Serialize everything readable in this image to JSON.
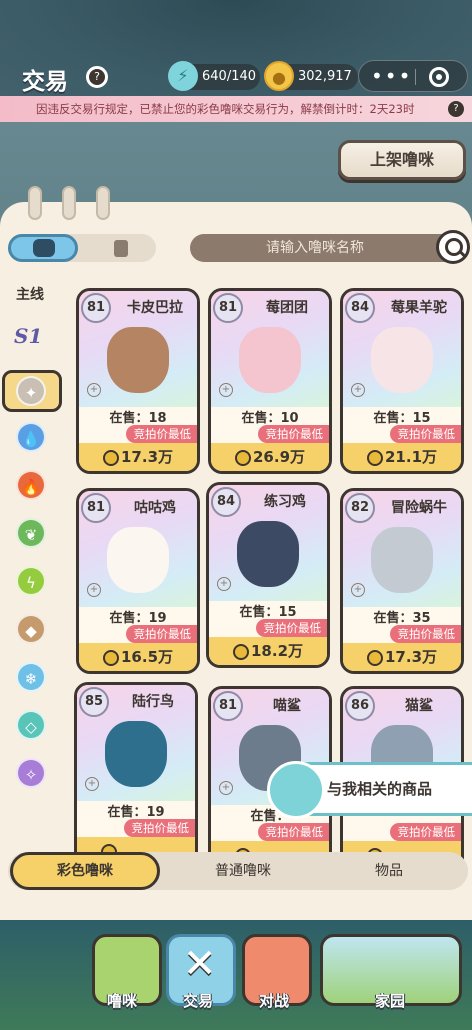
{
  "header": {
    "title": "交易",
    "energy": "640/140",
    "coins": "302,917"
  },
  "banner": {
    "text": "因违反交易行规定，已禁止您的彩色噜咪交易行为，解禁倒计时：2天23时"
  },
  "actions": {
    "list_label": "上架噜咪"
  },
  "search": {
    "placeholder": "请输入噜咪名称"
  },
  "sidebar": {
    "label": "主线",
    "season": "S1",
    "icons": [
      "neutral",
      "water",
      "fire",
      "grass",
      "electric",
      "earth",
      "ice",
      "crystal",
      "spirit"
    ]
  },
  "cards": [
    {
      "level": "81",
      "name": "卡皮巴拉",
      "stock": "在售：18",
      "tag": "竞拍价最低",
      "price": "17.3万",
      "color": "#b48463"
    },
    {
      "level": "81",
      "name": "莓团团",
      "stock": "在售：10",
      "tag": "竞拍价最低",
      "price": "26.9万",
      "color": "#f4c4cf"
    },
    {
      "level": "84",
      "name": "莓果羊驼",
      "stock": "在售：15",
      "tag": "竞拍价最低",
      "price": "21.1万",
      "color": "#f7e4e6"
    },
    {
      "level": "81",
      "name": "咕咕鸡",
      "stock": "在售：19",
      "tag": "竞拍价最低",
      "price": "16.5万",
      "color": "#fbf6ef"
    },
    {
      "level": "84",
      "name": "练习鸡",
      "stock": "在售：15",
      "tag": "竞拍价最低",
      "price": "18.2万",
      "color": "#3d4a63"
    },
    {
      "level": "82",
      "name": "冒险蜗牛",
      "stock": "在售：35",
      "tag": "竞拍价最低",
      "price": "17.3万",
      "color": "#c4cad2"
    },
    {
      "level": "85",
      "name": "陆行鸟",
      "stock": "在售：19",
      "tag": "竞拍价最低",
      "price": "",
      "color": "#2d6f8c"
    },
    {
      "level": "81",
      "name": "喵鲨",
      "stock": "在售：",
      "tag": "竞拍价最低",
      "price": "",
      "color": "#6c7c8c"
    },
    {
      "level": "86",
      "name": "猫鲨",
      "stock": "",
      "tag": "竞拍价最低",
      "price": "",
      "color": "#8ea0b2"
    }
  ],
  "related": {
    "label": "与我相关的商品"
  },
  "category_tabs": [
    "彩色噜咪",
    "普通噜咪",
    "物品"
  ],
  "dock": [
    "噜咪",
    "交易",
    "对战",
    "家园"
  ]
}
